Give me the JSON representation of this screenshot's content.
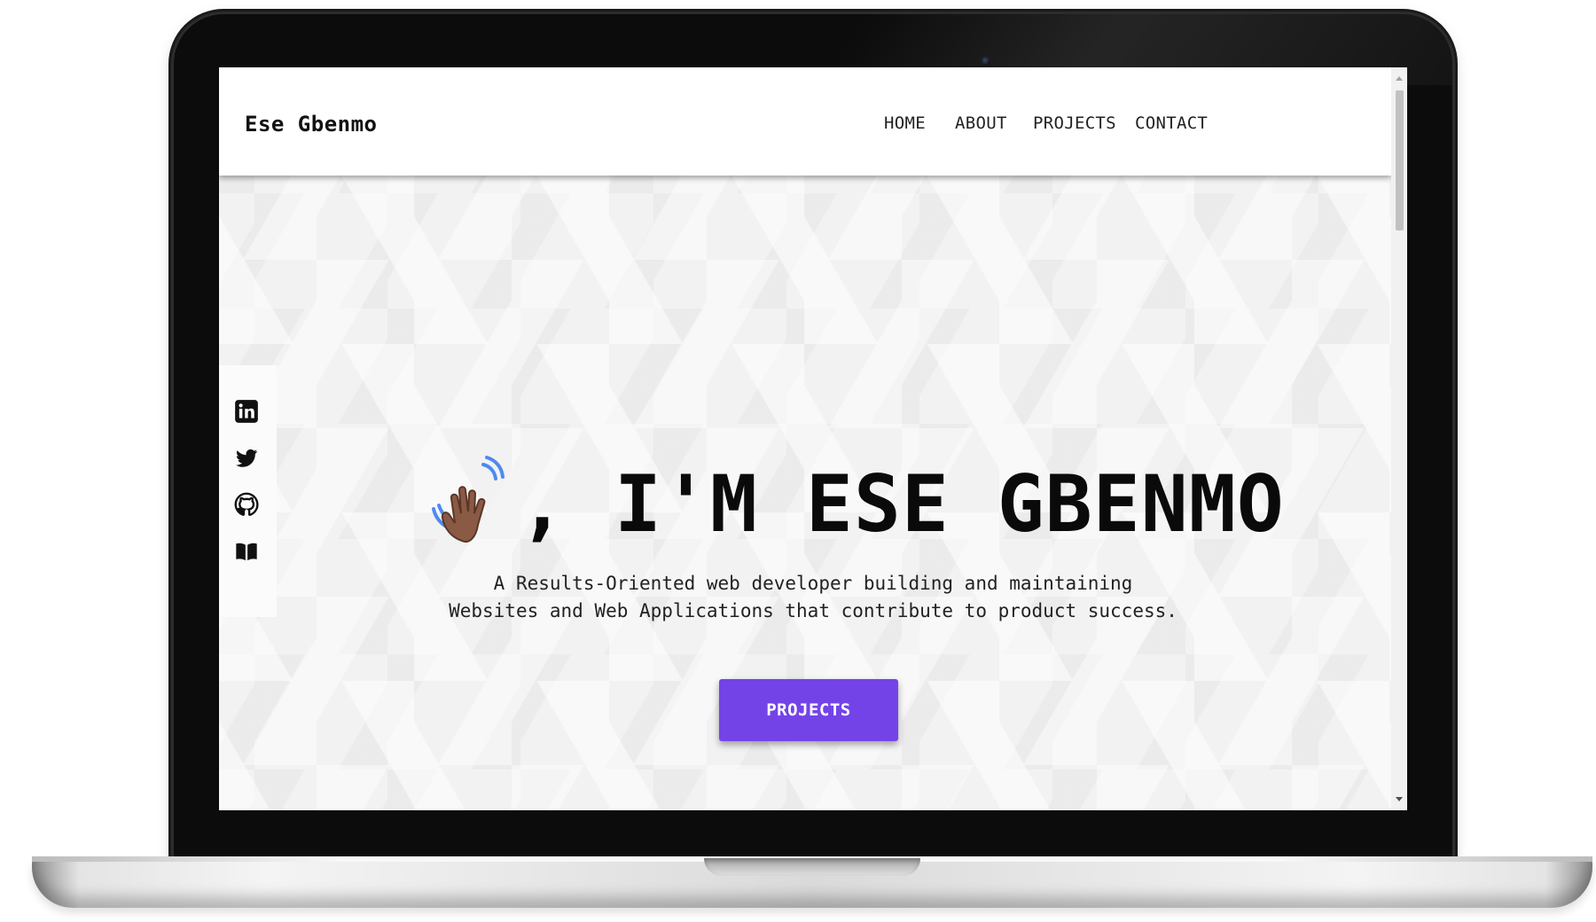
{
  "site": {
    "brand": "Ese Gbenmo",
    "nav": [
      {
        "label": "HOME"
      },
      {
        "label": "ABOUT"
      },
      {
        "label": "PROJECTS"
      },
      {
        "label": "CONTACT"
      }
    ]
  },
  "social": [
    {
      "icon": "linkedin-icon"
    },
    {
      "icon": "twitter-icon"
    },
    {
      "icon": "github-icon"
    },
    {
      "icon": "book-icon"
    }
  ],
  "hero": {
    "emoji_icon": "waving-hand-icon",
    "heading": ", I'M ESE GBENMO",
    "subtitle": "A Results-Oriented web developer building and maintaining Websites and Web Applications that contribute to product success.",
    "cta_label": "PROJECTS"
  },
  "colors": {
    "accent": "#7443e8",
    "navbar_bg": "#ffffff",
    "page_bg": "#f3f3f3",
    "text": "#111111"
  }
}
